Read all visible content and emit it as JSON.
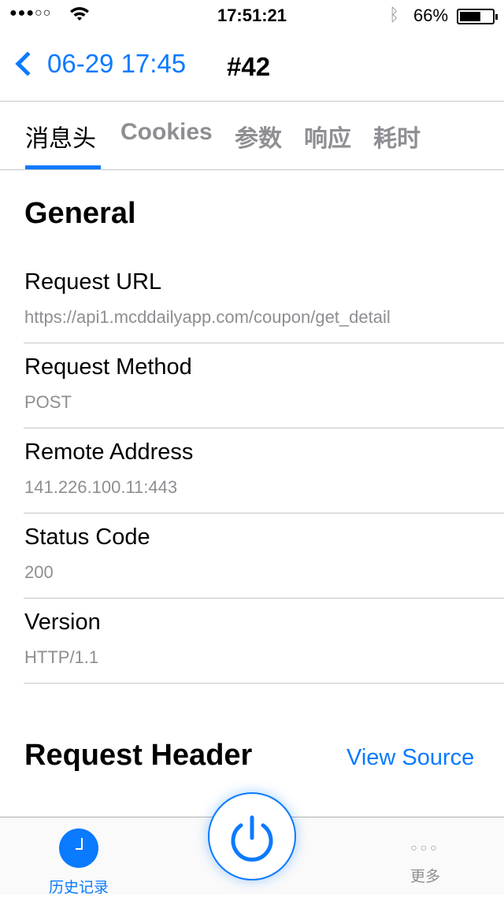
{
  "status_bar": {
    "signal": "●●●○○",
    "time": "17:51:21",
    "battery_percent": "66%",
    "battery_level": 0.66
  },
  "nav": {
    "back_label": "06-29 17:45",
    "title": "#42"
  },
  "tabs": [
    "消息头",
    "Cookies",
    "参数",
    "响应",
    "耗时"
  ],
  "general": {
    "title": "General",
    "rows": [
      {
        "label": "Request URL",
        "value": "https://api1.mcddailyapp.com/coupon/get_detail"
      },
      {
        "label": "Request Method",
        "value": "POST"
      },
      {
        "label": "Remote Address",
        "value": "141.226.100.11:443"
      },
      {
        "label": "Status Code",
        "value": "200"
      },
      {
        "label": "Version",
        "value": "HTTP/1.1"
      }
    ]
  },
  "request_header": {
    "title": "Request Header",
    "view_source": "View Source"
  },
  "tabbar": {
    "history": "历史记录",
    "more": "更多"
  },
  "colors": {
    "accent": "#0a7aff",
    "secondary": "#8e8e93"
  }
}
